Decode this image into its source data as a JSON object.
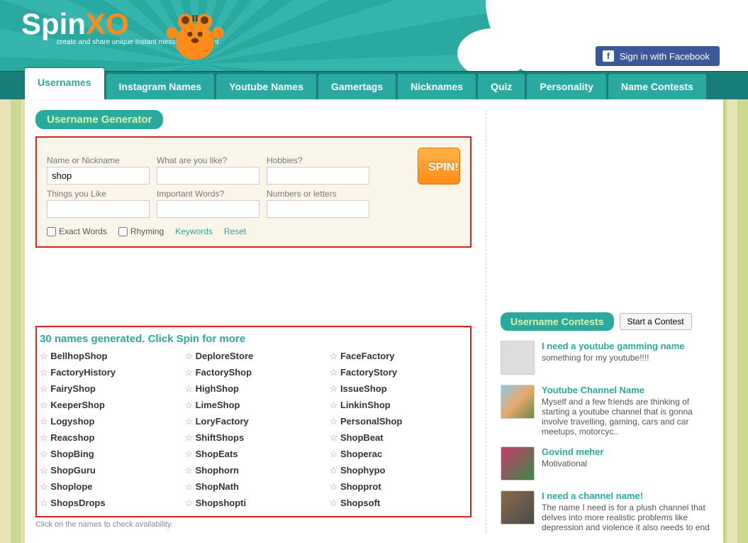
{
  "brand": {
    "name_a": "Spin",
    "name_b": "XO",
    "tagline": "create and share unique Instant messenger content"
  },
  "fb_button": "Sign in with Facebook",
  "tabs": [
    "Usernames",
    "Instagram Names",
    "Youtube Names",
    "Gamertags",
    "Nicknames",
    "Quiz",
    "Personality",
    "Name Contests"
  ],
  "panel_title": "Username Generator",
  "form": {
    "name_label": "Name or Nickname",
    "name_value": "shop",
    "like_label": "What are you like?",
    "hobbies_label": "Hobbies?",
    "things_label": "Things you Like",
    "words_label": "Important Words?",
    "numbers_label": "Numbers or letters",
    "spin": "SPIN!",
    "exact": "Exact Words",
    "rhyming": "Rhyming",
    "keywords": "Keywords",
    "reset": "Reset"
  },
  "generated_heading": "30 names generated. Click Spin for more",
  "names": [
    "BellhopShop",
    "DeploreStore",
    "FaceFactory",
    "FactoryHistory",
    "FactoryShop",
    "FactoryStory",
    "FairyShop",
    "HighShop",
    "IssueShop",
    "KeeperShop",
    "LimeShop",
    "LinkinShop",
    "Logyshop",
    "LoryFactory",
    "PersonalShop",
    "Reacshop",
    "ShiftShops",
    "ShopBeat",
    "ShopBing",
    "ShopEats",
    "Shoperac",
    "ShopGuru",
    "Shophorn",
    "Shophypo",
    "Shoplope",
    "ShopNath",
    "Shopprot",
    "ShopsDrops",
    "Shopshopti",
    "Shopsoft"
  ],
  "availability_note": "Click on the names to check availability.",
  "contests_title": "Username Contests",
  "start_contest": "Start a Contest",
  "contests": [
    {
      "title": "I need a youtube gamming name",
      "body": "something for my youtube!!!!",
      "avatar": ""
    },
    {
      "title": "Youtube Channel Name",
      "body": "Myself and a few friends are thinking of starting a youtube channel that is gonna involve travelling, gaming, cars and car meetups, motorcyc..",
      "avatar": "c1"
    },
    {
      "title": "Govind meher",
      "body": "Motivational",
      "avatar": "c2"
    },
    {
      "title": "I need a channel name!",
      "body": "The name I need is for a plush channel that delves into more realistic problems like depression and violence it also needs to end",
      "avatar": "c3"
    }
  ]
}
